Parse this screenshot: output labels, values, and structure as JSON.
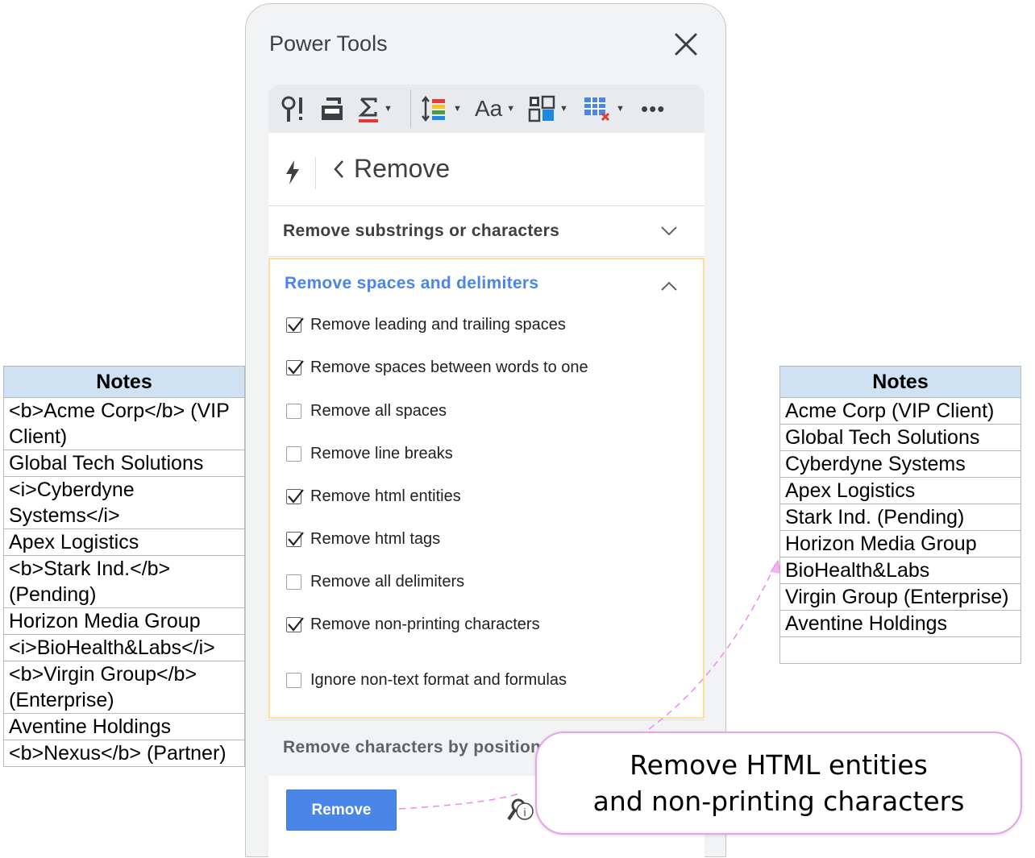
{
  "left_table": {
    "header": "Notes",
    "rows": [
      "<b>Acme Corp</b> (VIP Client)",
      "Global Tech Solutions",
      "<i>Cyberdyne Systems</i>",
      "Apex Logistics",
      "<b>Stark Ind.</b> (Pending)",
      "Horizon Media Group",
      "<i>BioHealth&Labs</i>",
      "<b>Virgin Group</b> (Enterprise)",
      "Aventine Holdings",
      "<b>Nexus</b> (Partner)"
    ]
  },
  "right_table": {
    "header": "Notes",
    "rows": [
      "Acme Corp (VIP Client)",
      "Global Tech Solutions",
      "Cyberdyne Systems",
      "Apex Logistics",
      "Stark Ind. (Pending)",
      "Horizon Media Group",
      "BioHealth&Labs",
      "Virgin Group (Enterprise)",
      "Aventine Holdings"
    ]
  },
  "panel": {
    "title": "Power Tools",
    "nav_title": "Remove",
    "toolbar_icons": [
      "find-icon",
      "split-icon",
      "sum-icon",
      "sort-icon",
      "text-case-icon",
      "convert-icon",
      "clear-icon",
      "more-icon"
    ],
    "sections": {
      "substrings": "Remove substrings or characters",
      "spaces": "Remove spaces and delimiters",
      "position": "Remove characters by position"
    },
    "options": [
      {
        "label": "Remove leading and trailing spaces",
        "checked": true
      },
      {
        "label": "Remove spaces between words to one",
        "checked": true
      },
      {
        "label": "Remove all spaces",
        "checked": false
      },
      {
        "label": "Remove line breaks",
        "checked": false
      },
      {
        "label": "Remove html entities",
        "checked": true
      },
      {
        "label": "Remove html tags",
        "checked": true
      },
      {
        "label": "Remove all delimiters",
        "checked": false
      },
      {
        "label": "Remove non-printing characters",
        "checked": true
      }
    ],
    "ignore_option": {
      "label": "Ignore non-text format and formulas",
      "checked": false
    },
    "remove_button": "Remove",
    "accent_color": "#4a86e8"
  },
  "callout": {
    "line1": "Remove HTML entities",
    "line2": "and non-printing characters"
  }
}
